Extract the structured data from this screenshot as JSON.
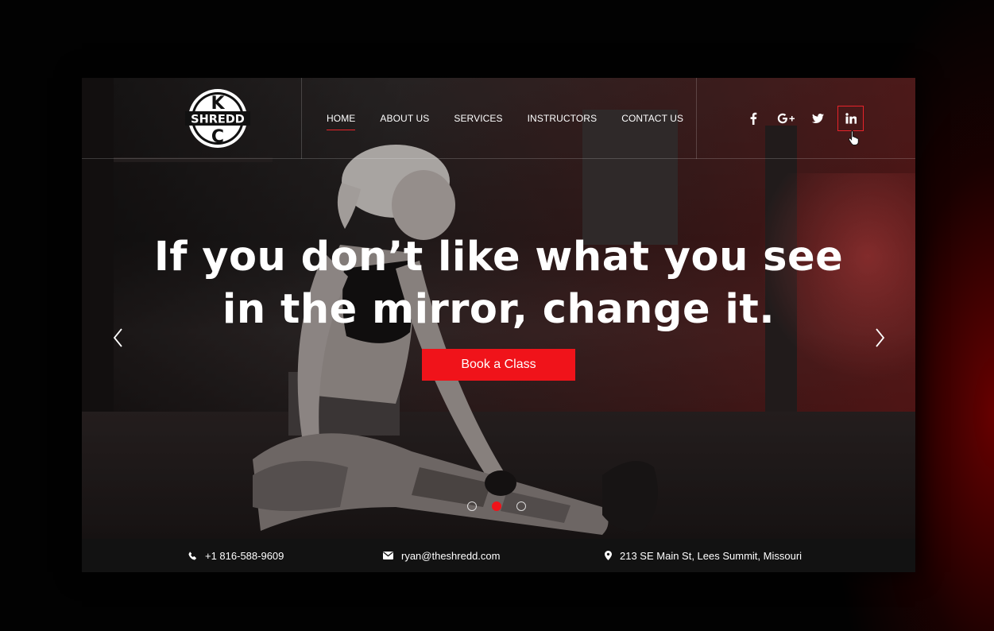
{
  "brand": {
    "logo_top": "K",
    "logo_middle": "SHREDD",
    "logo_bottom": "C"
  },
  "nav": {
    "items": [
      {
        "label": "HOME",
        "active": true
      },
      {
        "label": "ABOUT US",
        "active": false
      },
      {
        "label": "SERVICES",
        "active": false
      },
      {
        "label": "INSTRUCTORS",
        "active": false
      },
      {
        "label": "CONTACT US",
        "active": false
      }
    ]
  },
  "social": [
    {
      "icon": "facebook-icon",
      "glyph": "f"
    },
    {
      "icon": "google-plus-icon",
      "glyph": "G+"
    },
    {
      "icon": "twitter-icon",
      "glyph": "t"
    },
    {
      "icon": "linkedin-icon",
      "glyph": "in",
      "active": true
    }
  ],
  "hero": {
    "headline_line1": "If you don’t like what you see",
    "headline_line2": "in the mirror, change it.",
    "cta_label": "Book a Class",
    "slide_count": 3,
    "active_slide": 2
  },
  "contact": {
    "phone": "+1 816-588-9609",
    "email": "ryan@theshredd.com",
    "address": "213 SE Main St, Lees Summit, Missouri"
  },
  "colors": {
    "accent": "#f0131a",
    "bar": "#121212"
  }
}
